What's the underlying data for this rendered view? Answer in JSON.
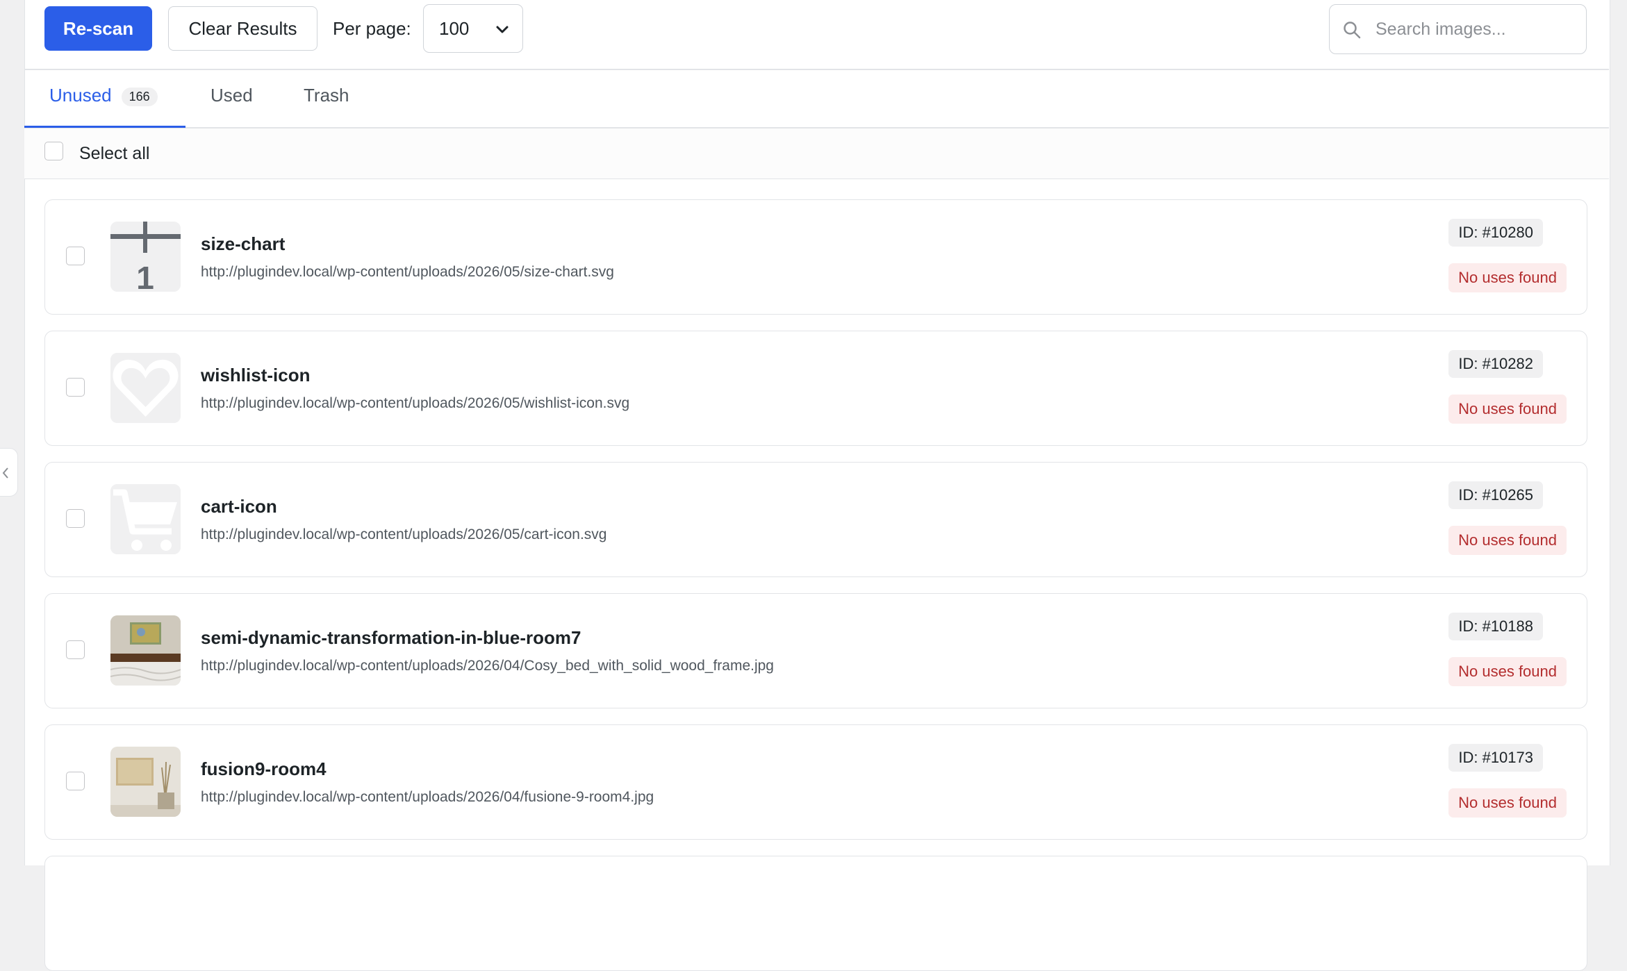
{
  "toolbar": {
    "rescan_label": "Re-scan",
    "clear_label": "Clear Results",
    "per_page_label": "Per page:",
    "per_page_value": "100",
    "search_placeholder": "Search images..."
  },
  "tabs": [
    {
      "label": "Unused",
      "count": "166",
      "active": true
    },
    {
      "label": "Used"
    },
    {
      "label": "Trash"
    }
  ],
  "select_all_label": "Select all",
  "items": [
    {
      "name": "size-chart",
      "url": "http://plugindev.local/wp-content/uploads/2026/05/size-chart.svg",
      "id": "ID: #10280",
      "status": "No uses found",
      "thumb": "size-chart-icon"
    },
    {
      "name": "wishlist-icon",
      "url": "http://plugindev.local/wp-content/uploads/2026/05/wishlist-icon.svg",
      "id": "ID: #10282",
      "status": "No uses found",
      "thumb": "heart-icon"
    },
    {
      "name": "cart-icon",
      "url": "http://plugindev.local/wp-content/uploads/2026/05/cart-icon.svg",
      "id": "ID: #10265",
      "status": "No uses found",
      "thumb": "cart-icon"
    },
    {
      "name": "semi-dynamic-transformation-in-blue-room7",
      "url": "http://plugindev.local/wp-content/uploads/2026/04/Cosy_bed_with_solid_wood_frame.jpg",
      "id": "ID: #10188",
      "status": "No uses found",
      "thumb": "bedroom-photo"
    },
    {
      "name": "fusion9-room4",
      "url": "http://plugindev.local/wp-content/uploads/2026/04/fusione-9-room4.jpg",
      "id": "ID: #10173",
      "status": "No uses found",
      "thumb": "room-photo"
    }
  ],
  "colors": {
    "accent": "#2b5ee8",
    "status_text": "#b32d2e",
    "status_bg": "#fcecec"
  }
}
